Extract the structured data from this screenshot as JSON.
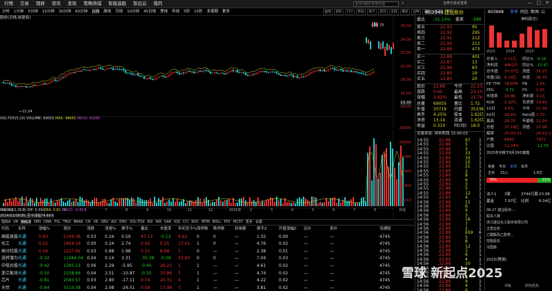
{
  "menu": [
    "行情",
    "交易",
    "理财",
    "资讯",
    "发现",
    "策略商城",
    "智能选股",
    "智远云",
    "我的"
  ],
  "search": {
    "placeholder": "股票/理财/常用功能"
  },
  "login": "证券交易未登录",
  "winctrls": [
    "—",
    "□",
    "✕"
  ],
  "periods": [
    "分时",
    "1分钟",
    "5分钟",
    "15分钟",
    "30分钟",
    "60分钟",
    "日线",
    "周线",
    "月线",
    "10分钟",
    "45日线",
    "季线",
    "年线",
    "5秒",
    "15秒",
    "多周期",
    "更多"
  ],
  "active_period": "日线",
  "tools": [
    "画线",
    "指标",
    "F10",
    "移动",
    "统计",
    "区间",
    "全屏",
    "模式",
    "品种",
    "选股",
    "信息",
    "返回"
  ],
  "stock_label": "股份(日线,前复权)",
  "price_axis": [
    "26.00",
    "24.00",
    "22.00",
    "20.00",
    "18.00",
    "16.00",
    "14.00"
  ],
  "price_axis_low": "13.30",
  "hi_marker": "26.70",
  "lo_marker": "12.24",
  "vol_title": {
    "prefix": "VOL-TDX(5,10)",
    "vol": "VOLUME: 69055",
    "ma5": "MA5: 48665",
    "ma10": "MA10: 41065"
  },
  "vol_axis": [
    "25000",
    "20000",
    "15000",
    "10000",
    "5000",
    "X10"
  ],
  "macd_title": {
    "prefix": "MACD(12,26,9)",
    "dif": "DIF: 0.39",
    "dea": "DEA: 0.61",
    "macd": "MACD: -0.45"
  },
  "date_range": "2024/02/08(四) 至今涨幅74.66%",
  "x_ticks": [
    "2024年",
    "3",
    "4",
    "5",
    "6",
    "7",
    "8",
    "9",
    "10",
    "11",
    "12",
    "2025年",
    "2",
    "3",
    "4",
    "5",
    "6",
    "7",
    "8",
    "日线"
  ],
  "ind_tabs": [
    "指标A",
    "VR",
    "MACD",
    "DMI",
    "DMA",
    "FSL",
    "TRIX",
    "BRAR",
    "CR",
    "VR",
    "OBV",
    "ASI",
    "EMV",
    "VOL-TDX",
    "RSI",
    "WR",
    "SAR",
    "KDJ",
    "CCI",
    "ROC",
    "MTM",
    "BOLL",
    "PSY",
    "MCST",
    "更多",
    "设置"
  ],
  "table": {
    "headers": [
      "代码",
      "名称",
      "涨幅%",
      "现价",
      "涨跌",
      "涨速%",
      "换手%",
      "量比",
      "市盈率",
      "年初至今%",
      "涨停数",
      "跌停数",
      "封单额",
      "换手Z",
      "开盘涨幅Z",
      "买价",
      "卖价",
      "流通股"
    ],
    "rows": [
      [
        "高股息股",
        "光通",
        "0.93",
        "5109.36",
        "0.03",
        "0.24",
        "0.59",
        "47.13",
        "-0.12",
        "9.62",
        "0",
        "0",
        "—",
        "1.55",
        "0.00",
        "—",
        "—",
        "4745"
      ],
      [
        "化工",
        "光通",
        "0.22",
        "1804.19",
        "0.00",
        "0.24",
        "2.74",
        "0.42",
        "0.25",
        "17.41",
        "1",
        "0",
        "—",
        "4.76",
        "0.02",
        "—",
        "—",
        "4745"
      ],
      [
        "高分红股",
        "光通",
        "0.16",
        "1227.92",
        "0.03",
        "0.88",
        "1.98",
        "0.15",
        "8.68",
        "1",
        "0",
        "—",
        "—",
        "2.38",
        "0.01",
        "—",
        "—",
        "4745"
      ],
      [
        "送转潜力",
        "光通",
        "-0.32",
        "11064.04",
        "0.04",
        "0.14",
        "3.31",
        "-35.38",
        "-0.09",
        "33.90",
        "0",
        "0",
        "—",
        "7.04",
        "0.03",
        "—",
        "—",
        "4745"
      ],
      [
        "中低价股",
        "光通",
        "-0.42",
        "1395.13",
        "0.06",
        "2.29",
        "-5.95",
        "-0.45",
        "26.22",
        "1",
        "1",
        "—",
        "—",
        "4.61",
        "0.02",
        "—",
        "—",
        "4745"
      ],
      [
        "浙江板块",
        "光通",
        "-0.50",
        "2158.66",
        "0.04",
        "2.51",
        "-10.87",
        "-0.35",
        "15.86",
        "7",
        "1",
        "—",
        "—",
        "4.74",
        "0.02",
        "—",
        "—",
        "4745"
      ],
      [
        "芯片",
        "光通",
        "-0.81",
        "2093.57",
        "0.03",
        "2.80",
        "-17.11",
        "0.74",
        "20.31",
        "4",
        "1",
        "—",
        "—",
        "4.22",
        "0.02",
        "—",
        "—",
        "4745"
      ],
      [
        "光伏",
        "光通",
        "-0.84",
        "3110.38",
        "0.04",
        "2.08",
        "-26.51",
        "0.09",
        "17.98",
        "3",
        "1",
        "—",
        "—",
        "3.81",
        "0.02",
        "—",
        "—",
        "4745"
      ]
    ]
  },
  "quote": {
    "code": "603948",
    "name": "建业股份",
    "ratio_label": "委比",
    "ratio": "-31.14%",
    "diff_label": "委差",
    "diff": "-586",
    "asks": [
      [
        "卖五",
        "22.93",
        "95"
      ],
      [
        "卖四",
        "22.92",
        "295"
      ],
      [
        "卖三",
        "22.91",
        "212"
      ],
      [
        "卖二",
        "22.90",
        "212"
      ],
      [
        "卖一",
        "22.89",
        "473"
      ]
    ],
    "bids": [
      [
        "买一",
        "22.88",
        "401"
      ],
      [
        "买二",
        "22.87",
        "13"
      ],
      [
        "买三",
        "22.86",
        "83"
      ],
      [
        "买四",
        "22.85",
        "19"
      ],
      [
        "买五",
        "22.83",
        "20"
      ]
    ],
    "stats": [
      [
        "现价",
        "22.88",
        "今开",
        "22.23"
      ],
      [
        "涨跌",
        "0.65",
        "最高",
        "23.10"
      ],
      [
        "涨幅",
        "2.92%",
        "最低",
        "21.76"
      ],
      [
        "总量",
        "69055",
        "量比",
        "1.72"
      ],
      [
        "外盘",
        "33719",
        "内盘",
        "35336"
      ],
      [
        "换手",
        "4.25%",
        "股本",
        "1.62亿"
      ],
      [
        "净资",
        "13.14",
        "流通",
        "1.62亿"
      ],
      [
        "收益",
        "0.310",
        "PE(动)",
        "18.0"
      ]
    ],
    "trade_title": "交易状态: 闭市阶段 15:00:03",
    "ticks": [
      [
        "14:55",
        "22.88",
        "97",
        "1"
      ],
      [
        "14:55",
        "22.88",
        "5",
        "1"
      ],
      [
        "14:55",
        "22.88",
        "3",
        "1"
      ],
      [
        "14:55",
        "22.88",
        "33",
        "1"
      ],
      [
        "14:55",
        "22.89",
        "35",
        "1"
      ],
      [
        "14:55",
        "22.89",
        "10",
        "1"
      ],
      [
        "14:55",
        "22.89",
        "21",
        "1"
      ],
      [
        "14:55",
        "22.89",
        "2",
        "1"
      ],
      [
        "14:55",
        "22.89",
        "8",
        "1"
      ],
      [
        "14:55",
        "22.89",
        "6",
        "1"
      ],
      [
        "14:55",
        "22.89",
        "3",
        "1"
      ],
      [
        "14:55",
        "22.88",
        "5",
        "1"
      ],
      [
        "14:55",
        "22.88",
        "12",
        "1"
      ],
      [
        "14:55",
        "22.89",
        "4",
        "1"
      ],
      [
        "14:56",
        "22.89",
        "11",
        "1"
      ],
      [
        "14:56",
        "22.88",
        "6",
        "1"
      ],
      [
        "14:56",
        "22.89",
        "9",
        "1"
      ],
      [
        "14:56",
        "22.88",
        "3",
        "1"
      ],
      [
        "14:56",
        "22.89",
        "16",
        "1"
      ],
      [
        "14:56",
        "22.88",
        "7",
        "1"
      ],
      [
        "14:56",
        "22.89",
        "2",
        "1"
      ],
      [
        "14:56",
        "22.88",
        "659",
        "6"
      ],
      [
        "14:56",
        "22.89",
        "5",
        "1"
      ],
      [
        "14:56",
        "22.88",
        "8",
        "1"
      ],
      [
        "14:56",
        "22.89",
        "12",
        "1"
      ],
      [
        "14:56",
        "22.88",
        "3",
        "1"
      ],
      [
        "14:56",
        "22.89",
        "6",
        "1"
      ],
      [
        "14:56",
        "22.89",
        "4",
        "1"
      ],
      [
        "14:56",
        "22.88",
        "10",
        "1"
      ],
      [
        "14:56",
        "22.89",
        "5",
        "1"
      ],
      [
        "14:56",
        "22.89",
        "7",
        "1"
      ],
      [
        "14:56",
        "22.88",
        "2",
        "1"
      ],
      [
        "14:56",
        "22.89",
        "9",
        "1"
      ],
      [
        "14:56",
        "22.88",
        "4",
        "1"
      ],
      [
        "14:56",
        "22.89",
        "6",
        "1"
      ]
    ]
  },
  "right2": {
    "code": "603948",
    "tabs": [
      "单季",
      "同比",
      "新闻",
      "公"
    ],
    "profit_label": "净利润(亿)",
    "bar_years": [
      "2023",
      "2024",
      "2025"
    ],
    "bar_values": [
      1.9,
      1.3,
      0.6,
      0.6,
      1.2,
      1.8,
      1.5,
      1.6
    ],
    "rows": [
      [
        "总收入",
        "5.11亿",
        "同比%",
        "-9.18"
      ],
      [
        "净利润",
        "4962万",
        "同比%",
        "-15.67"
      ],
      [
        "总市值",
        "37.07亿",
        "流值",
        "35.27"
      ],
      [
        "市盈(动)",
        "8.10亿",
        "市值",
        "36.75"
      ],
      [
        "PE TTM",
        "18.6PB",
        "PB",
        "1.54"
      ],
      [
        "PEG",
        "-3.71",
        "PS",
        "1.55"
      ],
      [
        "市销率",
        "16.86",
        "净利率",
        "9.13"
      ],
      [
        "ROE",
        "2.32%",
        "负债率",
        "19.60"
      ],
      [
        "10日",
        "4.5%",
        "今年",
        "31.39"
      ],
      [
        "60日",
        "29.9%",
        "Beta值",
        "2.33"
      ],
      [
        "最高",
        "26.70",
        "年最低",
        "12.24"
      ],
      [
        "总值",
        "37.18亿",
        "流值",
        "37.06"
      ],
      [
        "解禁",
        "25-03-31",
        "",
        "24-12-17"
      ],
      [
        "户数",
        "8842",
        "",
        "7871"
      ],
      [
        "比值",
        "12.24%",
        "",
        "-12.79"
      ]
    ],
    "report_note": "2025年中报于8月29日披露",
    "fund_tabs": [
      "资金",
      "今日",
      "本周",
      "本月"
    ],
    "fund_pct_in": "79%",
    "fund_pct_out": "21%",
    "fund_row": [
      "主买",
      "23入",
      "",
      "1.8亿"
    ],
    "holders": [
      [
        "法人1",
        "3家",
        "3744万股",
        "23.08"
      ],
      [
        "基金",
        "7.97亿",
        "比例",
        "6.04亿"
      ]
    ],
    "news": [
      "06-27 建业股份:…",
      "股东人数",
      "浙江建业化工股份有限公司",
      "主营业务",
      "乙酸酯及乙醇类…",
      "控股股东",
      "冯国栋"
    ],
    "eval_title": "2025(预测)",
    "footer": [
      "评级",
      "研究机构"
    ]
  },
  "watermark": "雪球 新起点2025"
}
